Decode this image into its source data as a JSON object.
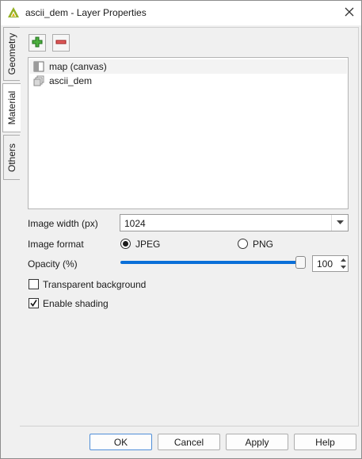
{
  "window": {
    "title": "ascii_dem - Layer Properties"
  },
  "tabs": [
    {
      "label": "Geometry",
      "active": false
    },
    {
      "label": "Material",
      "active": true
    },
    {
      "label": "Others",
      "active": false
    }
  ],
  "toolbar": {
    "add_icon": "plus-icon",
    "remove_icon": "minus-icon"
  },
  "layers": [
    {
      "label": "map (canvas)",
      "icon": "map-canvas-icon",
      "selected": true
    },
    {
      "label": "ascii_dem",
      "icon": "raster-layer-icon",
      "selected": false
    }
  ],
  "image_width": {
    "label": "Image width (px)",
    "value": "1024"
  },
  "image_format": {
    "label": "Image format",
    "options": [
      {
        "label": "JPEG",
        "checked": true
      },
      {
        "label": "PNG",
        "checked": false
      }
    ]
  },
  "opacity": {
    "label": "Opacity (%)",
    "value": "100",
    "level": 1.0
  },
  "transparent_background": {
    "label": "Transparent background",
    "checked": false
  },
  "enable_shading": {
    "label": "Enable shading",
    "checked": true
  },
  "buttons": {
    "ok": "OK",
    "cancel": "Cancel",
    "apply": "Apply",
    "help": "Help"
  },
  "colors": {
    "accent": "#0a6fd8",
    "add_green": "#2e9b2e",
    "remove_red": "#d64545"
  }
}
